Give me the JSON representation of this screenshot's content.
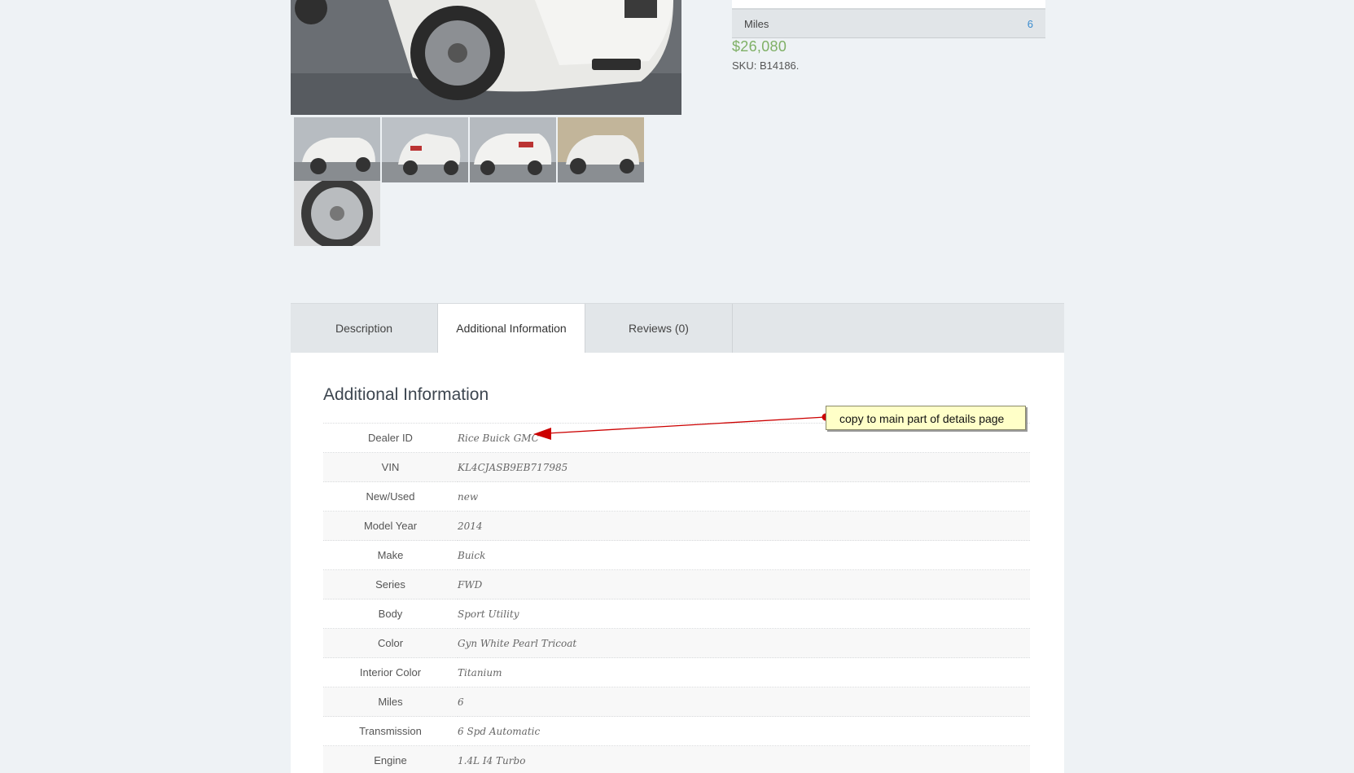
{
  "summary": {
    "miles_label": "Miles",
    "miles_value": "6",
    "price": "$26,080",
    "sku": "SKU: B14186."
  },
  "tabs": [
    {
      "label": "Description",
      "active": false
    },
    {
      "label": "Additional Information",
      "active": true
    },
    {
      "label": "Reviews (0)",
      "active": false
    }
  ],
  "panel": {
    "title": "Additional Information",
    "rows": [
      {
        "key": "Dealer ID",
        "value": "Rice Buick GMC"
      },
      {
        "key": "VIN",
        "value": "KL4CJASB9EB717985"
      },
      {
        "key": "New/Used",
        "value": "new"
      },
      {
        "key": "Model Year",
        "value": "2014"
      },
      {
        "key": "Make",
        "value": "Buick"
      },
      {
        "key": "Series",
        "value": "FWD"
      },
      {
        "key": "Body",
        "value": "Sport Utility"
      },
      {
        "key": "Color",
        "value": "Gyn White Pearl Tricoat"
      },
      {
        "key": "Interior Color",
        "value": "Titanium"
      },
      {
        "key": "Miles",
        "value": "6"
      },
      {
        "key": "Transmission",
        "value": "6 Spd Automatic"
      },
      {
        "key": "Engine",
        "value": "1.4L I4 Turbo"
      }
    ]
  },
  "annotation": {
    "text": "copy to main part of details page",
    "color": "#cc0000"
  },
  "colors": {
    "price": "#7fb066",
    "link": "#3a8ccf",
    "background": "#eef2f5"
  }
}
